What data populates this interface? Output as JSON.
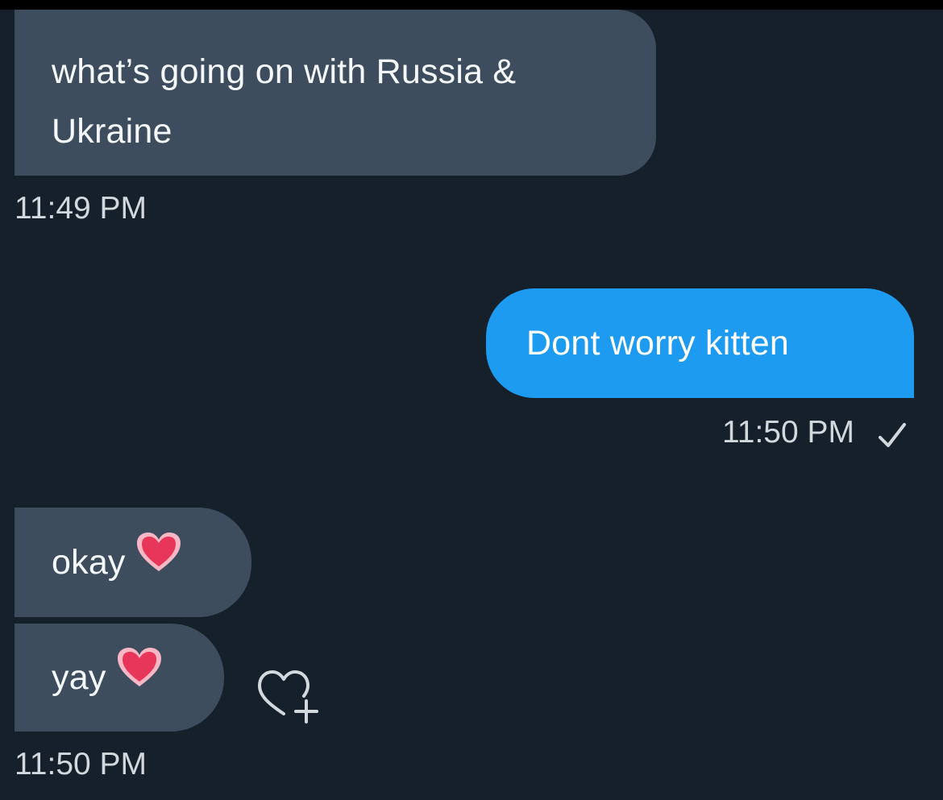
{
  "messages": [
    {
      "direction": "incoming",
      "text": "what’s going on with Russia & Ukraine",
      "time": "11:49 PM"
    },
    {
      "direction": "outgoing",
      "text": "Dont worry kitten",
      "time": "11:50 PM",
      "status_icon": "check-icon"
    },
    {
      "direction": "incoming",
      "text": "okay",
      "emoji": "pink-heart-icon"
    },
    {
      "direction": "incoming",
      "text": "yay",
      "emoji": "pink-heart-icon",
      "time": "11:50 PM",
      "action_icon": "add-reaction-heart-icon"
    }
  ],
  "colors": {
    "background": "#15202b",
    "incoming_bubble": "#3d4d5e",
    "outgoing_bubble": "#1d9bf0",
    "heart": "#e8365a",
    "timestamp": "#d3d8dc"
  }
}
